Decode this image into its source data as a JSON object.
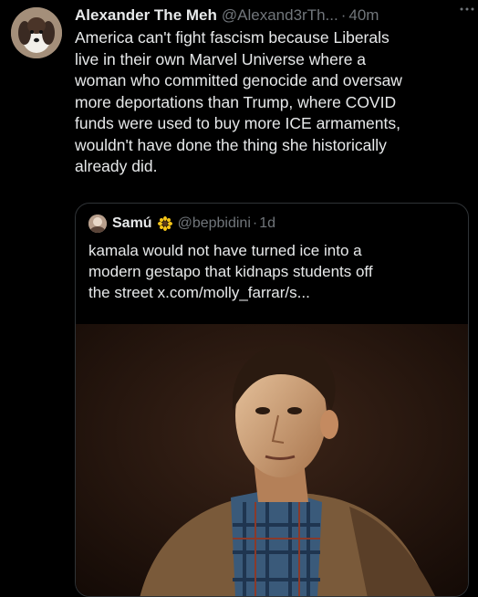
{
  "post": {
    "author_name": "Alexander The Meh",
    "author_handle": "@Alexand3rTh...",
    "separator": "·",
    "time": "40m",
    "more_icon": "more-dots-icon",
    "text_lines": [
      "America can't fight fascism because Liberals",
      "live in their own Marvel Universe where a",
      "woman who committed genocide and oversaw",
      "more deportations than Trump, where COVID",
      "funds were used to buy more ICE armaments,",
      "wouldn't have done the thing she historically",
      "already did."
    ]
  },
  "quote": {
    "author_name": "Samú",
    "sunflower_icon": "sunflower-emoji-icon",
    "author_handle": "@bepbidini",
    "separator": "·",
    "time": "1d",
    "text_lines": [
      "kamala would not have turned ice into a",
      "modern gestapo that kidnaps students off",
      "the street x.com/molly_farrar/s..."
    ],
    "media_description_icon": "painting-image"
  },
  "colors": {
    "background": "#000000",
    "text": "#e7e9ea",
    "muted": "#71767b",
    "border": "#2f3336"
  }
}
